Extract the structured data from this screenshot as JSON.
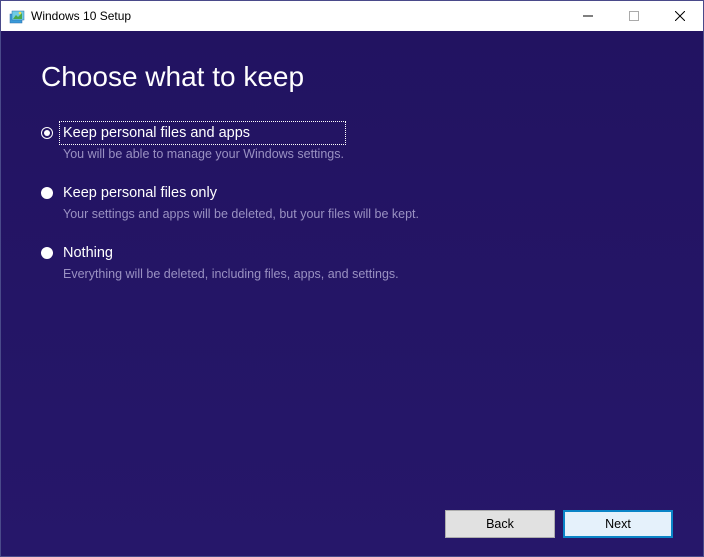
{
  "window": {
    "title": "Windows 10 Setup"
  },
  "heading": "Choose what to keep",
  "options": [
    {
      "label": "Keep personal files and apps",
      "desc": "You will be able to manage your Windows settings.",
      "selected": true,
      "focused": true
    },
    {
      "label": "Keep personal files only",
      "desc": "Your settings and apps will be deleted, but your files will be kept.",
      "selected": false,
      "focused": false
    },
    {
      "label": "Nothing",
      "desc": "Everything will be deleted, including files, apps, and settings.",
      "selected": false,
      "focused": false
    }
  ],
  "buttons": {
    "back": "Back",
    "next": "Next"
  }
}
